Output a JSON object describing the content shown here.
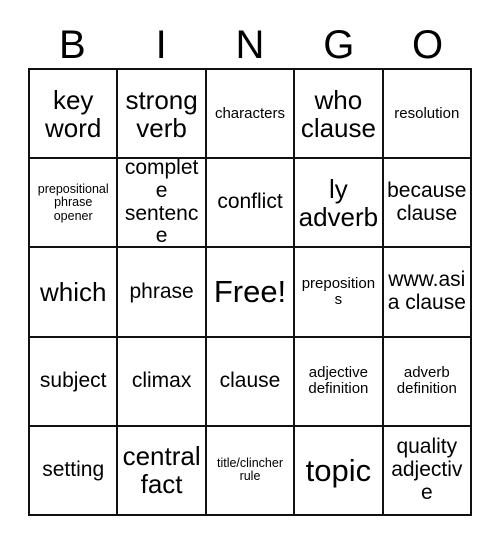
{
  "card": {
    "type": "bingo-card",
    "title_letters": [
      "B",
      "I",
      "N",
      "G",
      "O"
    ],
    "columns": 5,
    "rows": 5,
    "free_space": {
      "row": 3,
      "column": 3,
      "label": "Free!"
    },
    "colors": {
      "background": "#ffffff",
      "border": "#111111",
      "text": "#000000"
    },
    "cells": [
      {
        "text": "key word",
        "size": "lg"
      },
      {
        "text": "strong verb",
        "size": "lg"
      },
      {
        "text": "characters",
        "size": "sm"
      },
      {
        "text": "who clause",
        "size": "lg"
      },
      {
        "text": "resolution",
        "size": "sm"
      },
      {
        "text": "prepositional phrase opener",
        "size": "xs"
      },
      {
        "text": "complete sentence",
        "size": "md"
      },
      {
        "text": "conflict",
        "size": "md"
      },
      {
        "text": "ly adverb",
        "size": "lg"
      },
      {
        "text": "because clause",
        "size": "md"
      },
      {
        "text": "which",
        "size": "lg"
      },
      {
        "text": "phrase",
        "size": "md"
      },
      {
        "text": "Free!",
        "size": "xl"
      },
      {
        "text": "prepositions",
        "size": "sm"
      },
      {
        "text": "www.asia clause",
        "size": "md"
      },
      {
        "text": "subject",
        "size": "md"
      },
      {
        "text": "climax",
        "size": "md"
      },
      {
        "text": "clause",
        "size": "md"
      },
      {
        "text": "adjective definition",
        "size": "sm"
      },
      {
        "text": "adverb definition",
        "size": "sm"
      },
      {
        "text": "setting",
        "size": "md"
      },
      {
        "text": "central fact",
        "size": "lg"
      },
      {
        "text": "title/clincher rule",
        "size": "xs"
      },
      {
        "text": "topic",
        "size": "xl"
      },
      {
        "text": "quality adjective",
        "size": "md"
      }
    ]
  }
}
